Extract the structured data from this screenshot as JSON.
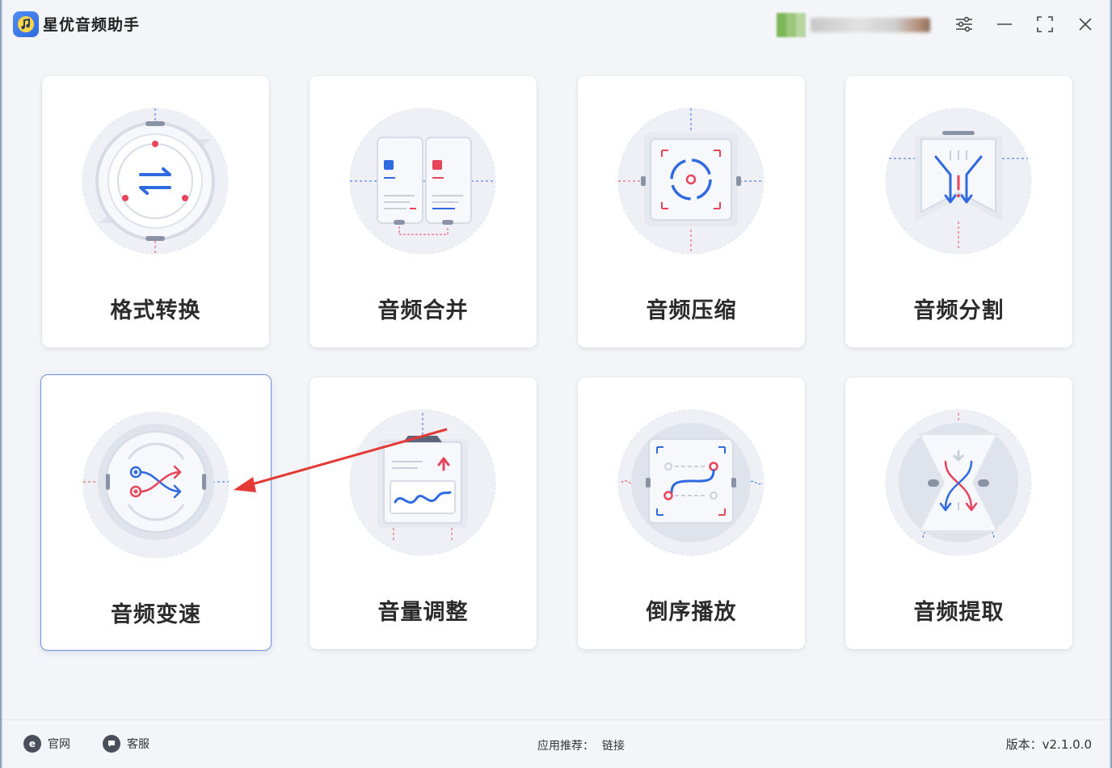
{
  "app": {
    "title": "星优音频助手"
  },
  "titlebar": {
    "icons": [
      "user-avatar",
      "settings-sliders-icon",
      "minimize-icon",
      "maximize-icon",
      "close-icon"
    ]
  },
  "features": [
    {
      "label": "格式转换",
      "icon": "format-convert-icon"
    },
    {
      "label": "音频合并",
      "icon": "audio-merge-icon"
    },
    {
      "label": "音频压缩",
      "icon": "audio-compress-icon"
    },
    {
      "label": "音频分割",
      "icon": "audio-split-icon"
    },
    {
      "label": "音频变速",
      "icon": "audio-speed-icon"
    },
    {
      "label": "音量调整",
      "icon": "volume-adjust-icon"
    },
    {
      "label": "倒序播放",
      "icon": "reverse-play-icon"
    },
    {
      "label": "音频提取",
      "icon": "audio-extract-icon"
    }
  ],
  "footer": {
    "website_label": "官网",
    "service_label": "客服",
    "recommend_label": "应用推荐：",
    "link_label": "链接",
    "version_label": "版本：v2.1.0.0"
  },
  "colors": {
    "accent_blue": "#2f6ae0",
    "accent_red": "#e8445a",
    "selected_border": "#6f8fdc",
    "annotation_arrow": "#e53935"
  }
}
